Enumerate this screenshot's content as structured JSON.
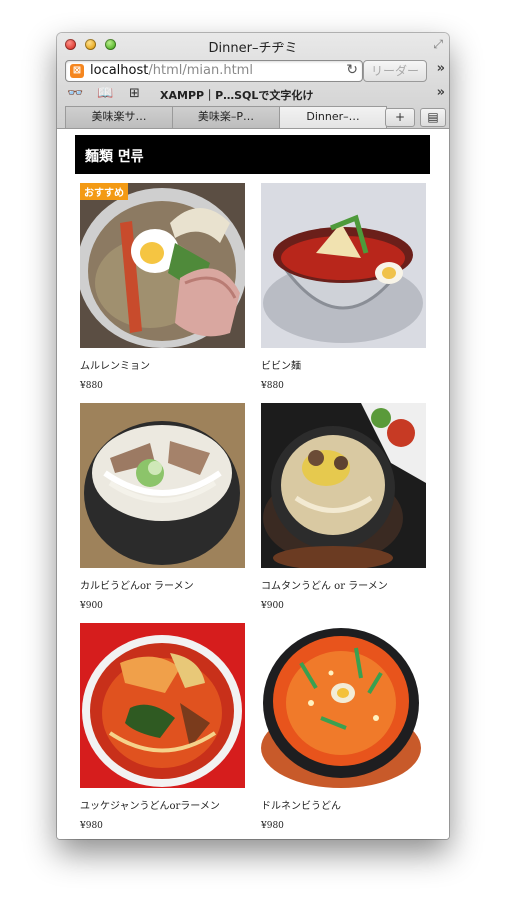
{
  "window": {
    "title": "Dinner–チヂミ"
  },
  "address": {
    "host": "localhost",
    "path": "/html/mian.html",
    "reader_label": "リーダー"
  },
  "bookmarks": {
    "item": "XAMPP｜P…SQLで文字化け"
  },
  "tabs": [
    {
      "label": "美味楽サ…"
    },
    {
      "label": "美味楽–P…"
    },
    {
      "label": "Dinner–…"
    }
  ],
  "page": {
    "header": "麵類 면류",
    "badge": "おすすめ",
    "items": [
      {
        "name": "ムルレンミョン",
        "price": "¥880"
      },
      {
        "name": "ビビン麺",
        "price": "¥880"
      },
      {
        "name": "カルビうどんor ラーメン",
        "price": "¥900"
      },
      {
        "name": "コムタンうどん or ラーメン",
        "price": "¥900"
      },
      {
        "name": "ユッケジャンうどんorラーメン",
        "price": "¥980"
      },
      {
        "name": "ドルネンビうどん",
        "price": "¥980"
      }
    ]
  },
  "colors": {
    "header_bg": "#000000",
    "badge_bg": "#f39a14",
    "site_icon": "#f5861f"
  }
}
